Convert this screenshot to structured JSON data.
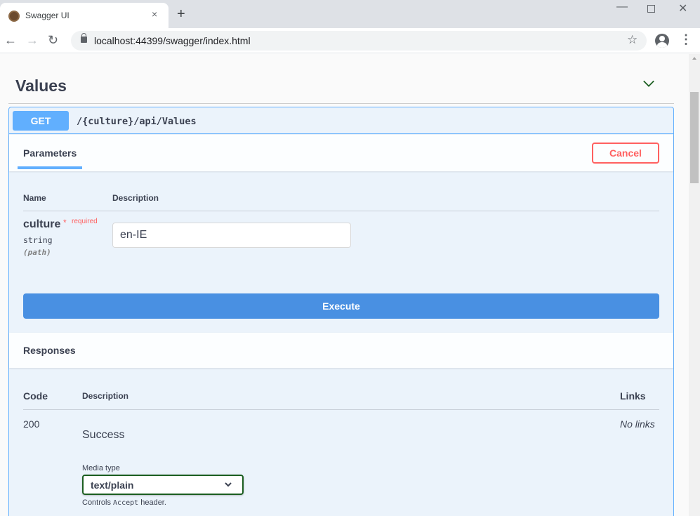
{
  "browser": {
    "tab_title": "Swagger UI",
    "tab_close": "×",
    "new_tab": "+",
    "url": "localhost:44399/swagger/index.html",
    "nav": {
      "back": "←",
      "forward": "→",
      "reload": "↻"
    },
    "star": "☆",
    "menu": "⋮",
    "win_min": "—",
    "win_close": "✕"
  },
  "section": {
    "title": "Values",
    "chevron_icon": "chevron-down-icon"
  },
  "operation": {
    "method": "GET",
    "path": "/{culture}/api/Values",
    "accent_color": "#61affe"
  },
  "parameters": {
    "tab_label": "Parameters",
    "cancel_label": "Cancel",
    "col_name": "Name",
    "col_description": "Description",
    "items": [
      {
        "name": "culture",
        "required_star": "*",
        "required_label": "required",
        "type": "string",
        "in": "(path)",
        "value": "en-IE"
      }
    ]
  },
  "execute_label": "Execute",
  "responses": {
    "title": "Responses",
    "col_code": "Code",
    "col_description": "Description",
    "col_links": "Links",
    "rows": [
      {
        "code": "200",
        "description": "Success",
        "links": "No links",
        "media_type_label": "Media type",
        "media_type": "text/plain",
        "note_prefix": "Controls",
        "note_code": "Accept",
        "note_suffix": "header."
      }
    ]
  }
}
